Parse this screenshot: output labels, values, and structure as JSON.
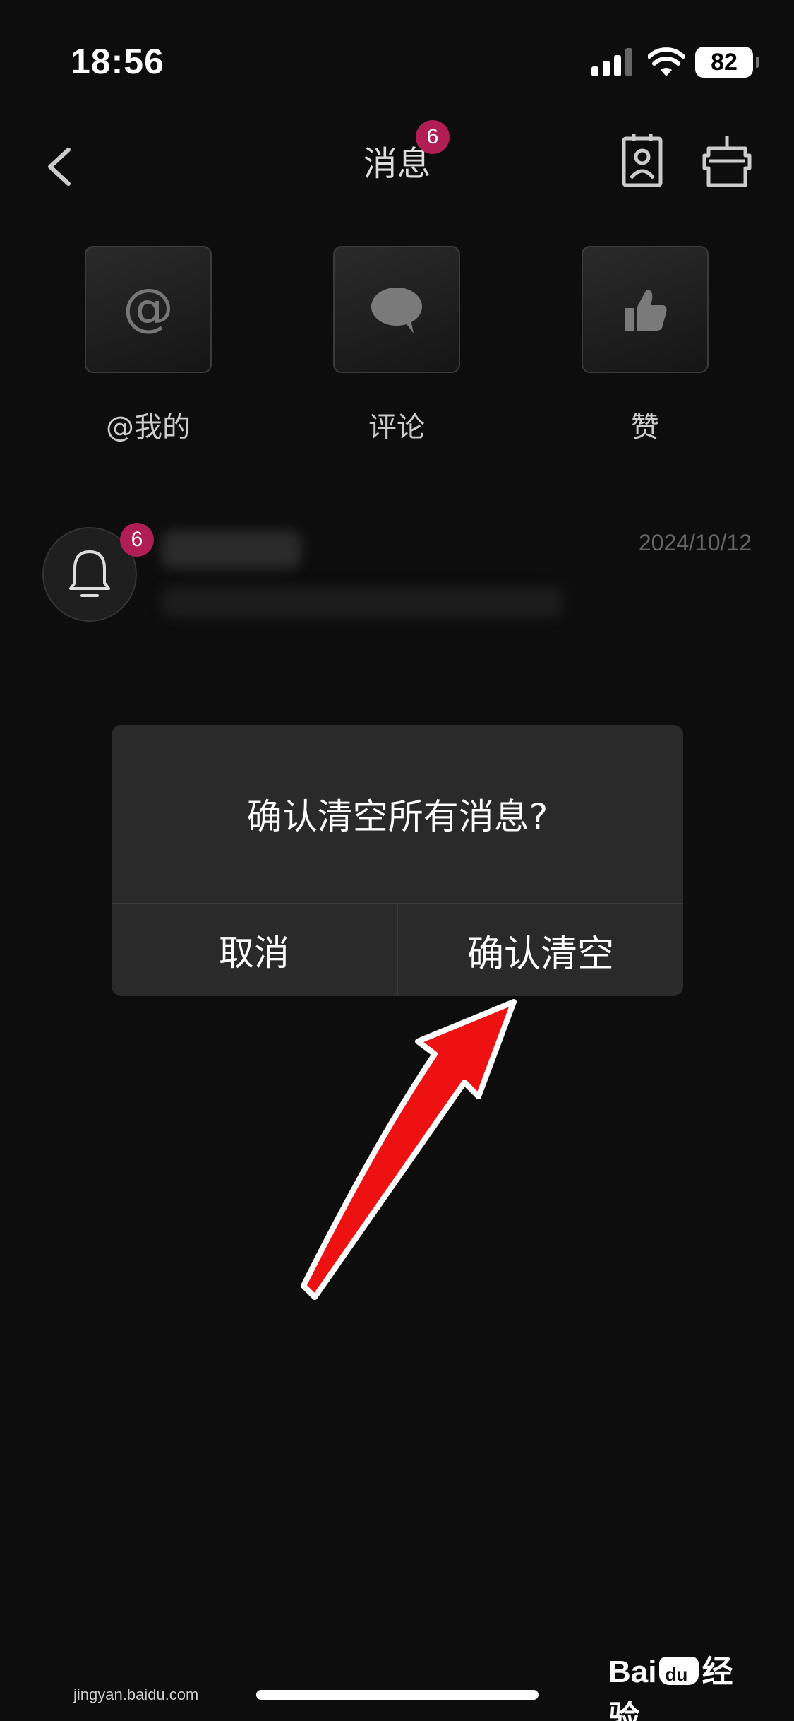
{
  "status_bar": {
    "time": "18:56",
    "battery": "82",
    "icons": [
      "cellular-signal-icon",
      "wifi-icon",
      "battery-icon"
    ]
  },
  "nav": {
    "title": "消息",
    "badge": "6",
    "icons": [
      "back-chevron-icon",
      "contacts-icon",
      "robot-icon"
    ]
  },
  "categories": [
    {
      "label": "@我的",
      "icon": "at-icon"
    },
    {
      "label": "评论",
      "icon": "speech-bubble-icon"
    },
    {
      "label": "赞",
      "icon": "thumbs-up-icon"
    }
  ],
  "notification": {
    "badge": "6",
    "date": "2024/10/12",
    "icon": "bell-icon"
  },
  "dialog": {
    "message": "确认清空所有消息?",
    "cancel_label": "取消",
    "confirm_label": "确认清空"
  },
  "watermark": {
    "brand": "Bai",
    "brand_suffix": "经验",
    "url": "jingyan.baidu.com"
  },
  "colors": {
    "background": "#0d0d0d",
    "badge": "#b01e55",
    "dialog": "#2a2a2a",
    "arrow": "#ee1111"
  }
}
